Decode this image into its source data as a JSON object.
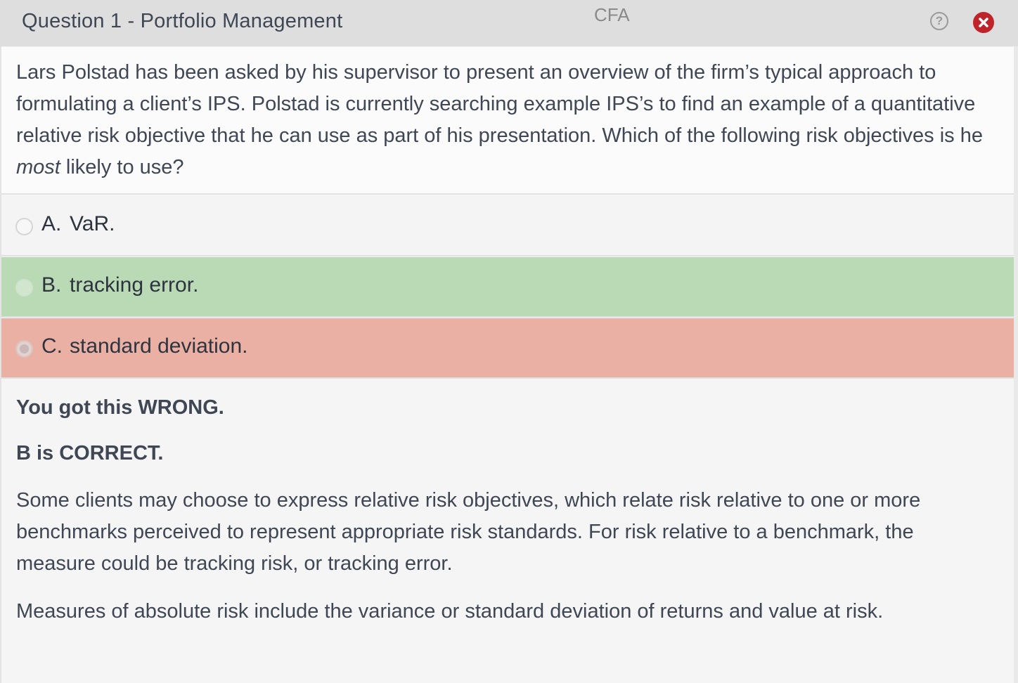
{
  "window": {
    "title": "Question 1 - Portfolio Management",
    "brand": "CFA",
    "help_label": "?"
  },
  "question": {
    "text_before": "Lars Polstad has been asked by his supervisor to present an overview of the firm’s typical approach to formulating a client’s IPS. Polstad is currently searching example IPS’s to find an example of a quantitative relative risk objective that he can use as part of his presentation. Which of the following risk objectives is he ",
    "emphasis": "most",
    "text_after": " likely to use?"
  },
  "answers": [
    {
      "letter": "A.",
      "text": "VaR.",
      "state": "neutral"
    },
    {
      "letter": "B.",
      "text": "tracking error.",
      "state": "correct"
    },
    {
      "letter": "C.",
      "text": "standard deviation.",
      "state": "selected-wrong"
    }
  ],
  "explanation": {
    "result": "You got this WRONG.",
    "correct_answer": "B is CORRECT.",
    "paragraph1": "Some clients may choose to express relative risk objectives, which relate risk relative to one or more benchmarks perceived to represent appropriate risk standards.  For risk relative to a benchmark, the measure could be tracking risk, or tracking error.",
    "paragraph2": "Measures of absolute risk include the variance or standard deviation of returns and value at risk."
  },
  "colors": {
    "correct_bg": "#b9dab5",
    "wrong_bg": "#ebb0a4",
    "close_button": "#c0232a"
  }
}
